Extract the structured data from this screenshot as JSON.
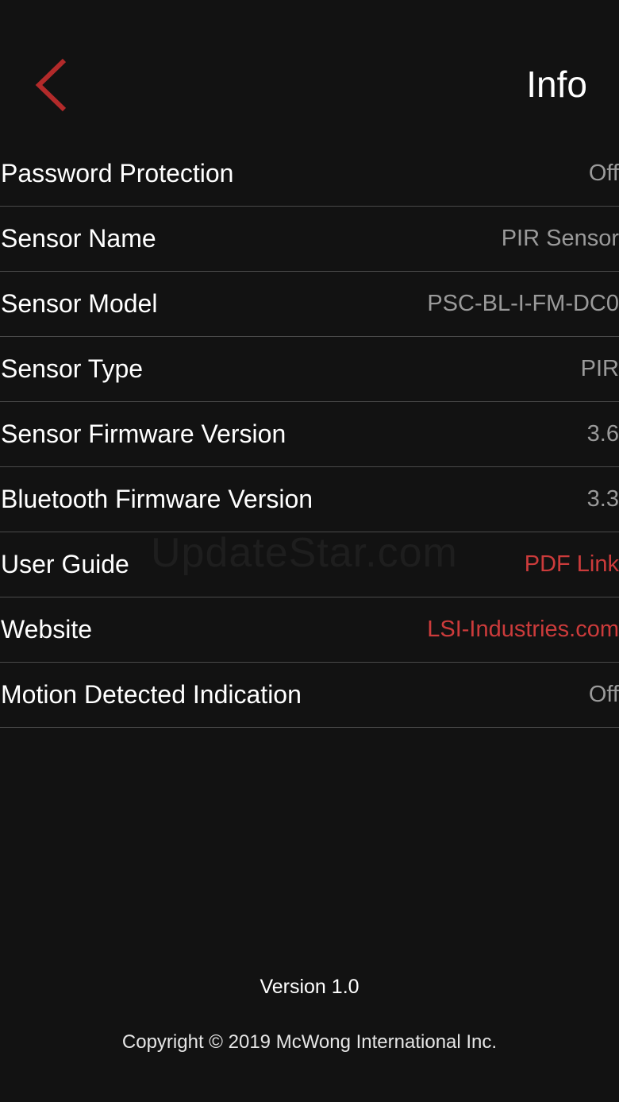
{
  "header": {
    "title": "Info",
    "back_icon": "chevron-left-icon",
    "accent_color": "#b22a2a"
  },
  "rows": [
    {
      "label": "Password Protection",
      "value": "Off"
    },
    {
      "label": "Sensor Name",
      "value": "PIR Sensor"
    },
    {
      "label": "Sensor Model",
      "value": "PSC-BL-I-FM-DC0"
    },
    {
      "label": "Sensor Type",
      "value": "PIR"
    },
    {
      "label": "Sensor Firmware Version",
      "value": "3.6"
    },
    {
      "label": "Bluetooth Firmware Version",
      "value": "3.3"
    },
    {
      "label": "User Guide",
      "value": "PDF Link"
    },
    {
      "label": "Website",
      "value": "LSI-Industries.com"
    },
    {
      "label": "Motion Detected Indication",
      "value": "Off"
    }
  ],
  "watermark": "UpdateStar.com",
  "footer": {
    "version": "Version 1.0",
    "copyright": "Copyright © 2019 McWong International Inc."
  }
}
